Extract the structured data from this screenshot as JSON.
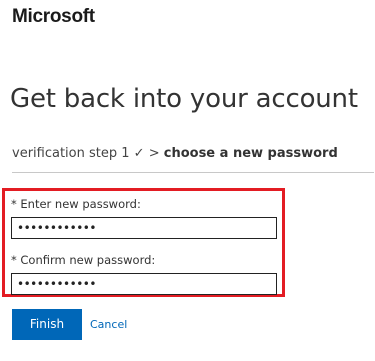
{
  "brand": {
    "logo_text": "Microsoft"
  },
  "page": {
    "title": "Get back into your account"
  },
  "breadcrumb": {
    "step1": "verification step 1",
    "step1_check": "✓",
    "separator": ">",
    "current": "choose a new password"
  },
  "form": {
    "new_password": {
      "label": "* Enter new password:",
      "value": "••••••••••••"
    },
    "confirm_password": {
      "label": "* Confirm new password:",
      "value": "••••••••••••"
    }
  },
  "actions": {
    "finish_label": "Finish",
    "cancel_label": "Cancel"
  },
  "colors": {
    "accent": "#0067b8",
    "highlight_box": "#e31c23"
  }
}
